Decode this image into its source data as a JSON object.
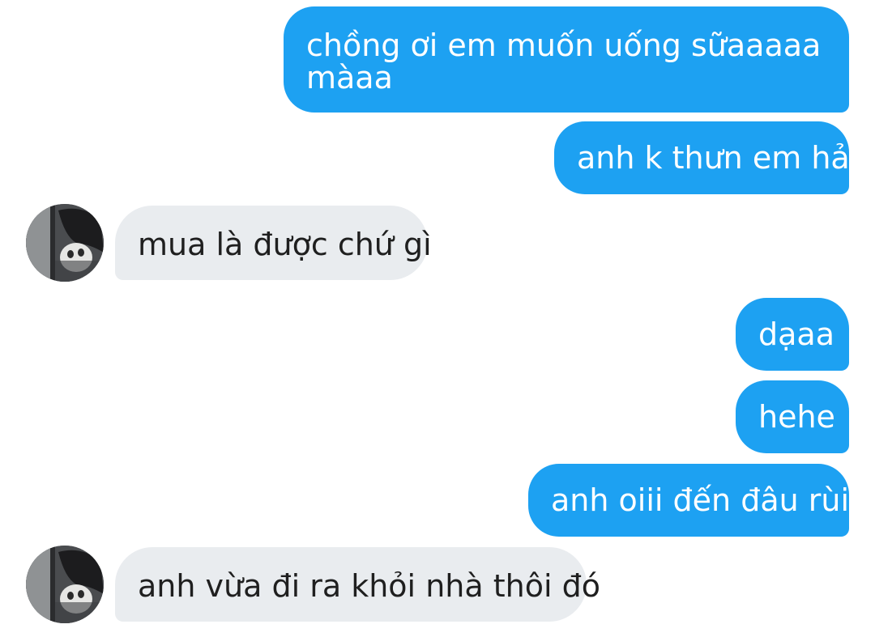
{
  "conversation": {
    "messages": [
      {
        "direction": "sent",
        "text": "chồng ơi em muốn uống sữaaaaa màaa"
      },
      {
        "direction": "sent",
        "text": "anh k thưn em hả"
      },
      {
        "direction": "received",
        "text": "mua là được chứ gì"
      },
      {
        "direction": "sent",
        "text": "dạaa"
      },
      {
        "direction": "sent",
        "text": "hehe"
      },
      {
        "direction": "sent",
        "text": "anh oiii đến đâu rùi"
      },
      {
        "direction": "received",
        "text": "anh vừa đi ra khỏi nhà thôi đó"
      }
    ]
  },
  "colors": {
    "sent_bubble": "#1da1f2",
    "sent_text": "#ffffff",
    "received_bubble": "#e9ecef",
    "received_text": "#1f1f1f",
    "background": "#ffffff"
  },
  "icons": {
    "avatar": "user-avatar-photo"
  }
}
